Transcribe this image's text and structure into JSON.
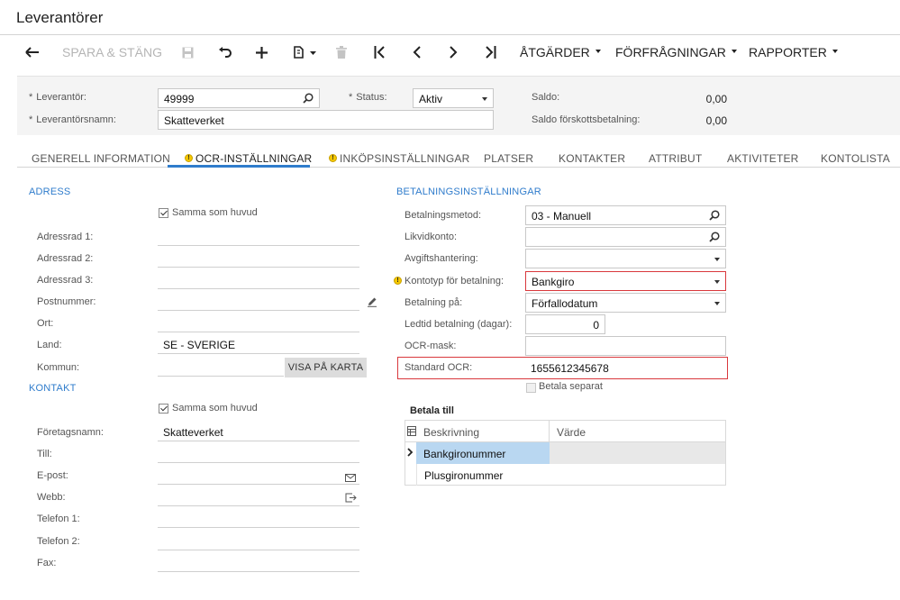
{
  "window": {
    "title": "Leverantörer"
  },
  "toolbar": {
    "save_close_label": "SPARA & STÄNG",
    "actions_label": "ÅTGÄRDER",
    "inquiries_label": "FÖRFRÅGNINGAR",
    "reports_label": "RAPPORTER",
    "icons": [
      "back-arrow-icon",
      "save-icon",
      "undo-icon",
      "add-icon",
      "copy-paste-icon",
      "delete-icon",
      "first-record-icon",
      "previous-record-icon",
      "next-record-icon",
      "last-record-icon"
    ]
  },
  "header": {
    "vendor_label": "Leverantör:",
    "vendor_value": "49999",
    "vendor_name_label": "Leverantörsnamn:",
    "vendor_name_value": "Skatteverket",
    "status_label": "Status:",
    "status_value": "Aktiv",
    "balance_label": "Saldo:",
    "balance_value": "0,00",
    "prepayment_balance_label": "Saldo förskottsbetalning:",
    "prepayment_balance_value": "0,00",
    "required_marker": "*"
  },
  "tabs": [
    {
      "label": "GENERELL INFORMATION",
      "warning": false,
      "active": false
    },
    {
      "label": "OCR-INSTÄLLNINGAR",
      "warning": true,
      "active": true
    },
    {
      "label": "INKÖPSINSTÄLLNINGAR",
      "warning": true,
      "active": false
    },
    {
      "label": "PLATSER",
      "warning": false,
      "active": false
    },
    {
      "label": "KONTAKTER",
      "warning": false,
      "active": false
    },
    {
      "label": "ATTRIBUT",
      "warning": false,
      "active": false
    },
    {
      "label": "AKTIVITETER",
      "warning": false,
      "active": false
    },
    {
      "label": "KONTOLISTA",
      "warning": false,
      "active": false
    }
  ],
  "address": {
    "section_title": "ADRESS",
    "same_as_main_label": "Samma som huvud",
    "same_as_main_checked": true,
    "line1_label": "Adressrad 1:",
    "line2_label": "Adressrad 2:",
    "line3_label": "Adressrad 3:",
    "postal_label": "Postnummer:",
    "city_label": "Ort:",
    "country_label": "Land:",
    "country_value": "SE - SVERIGE",
    "municipality_label": "Kommun:",
    "show_map_label": "VISA PÅ KARTA"
  },
  "contact": {
    "section_title": "KONTAKT",
    "same_as_main_label": "Samma som huvud",
    "same_as_main_checked": true,
    "company_label": "Företagsnamn:",
    "company_value": "Skatteverket",
    "attention_label": "Till:",
    "email_label": "E-post:",
    "web_label": "Webb:",
    "phone1_label": "Telefon 1:",
    "phone2_label": "Telefon 2:",
    "fax_label": "Fax:"
  },
  "payment": {
    "section_title": "BETALNINGSINSTÄLLNINGAR",
    "method_label": "Betalningsmetod:",
    "method_value": "03 - Manuell",
    "cash_account_label": "Likvidkonto:",
    "fee_handling_label": "Avgiftshantering:",
    "account_type_label": "Kontotyp för betalning:",
    "account_type_value": "Bankgiro",
    "pay_on_label": "Betalning på:",
    "pay_on_value": "Förfallodatum",
    "lead_time_label": "Ledtid betalning (dagar):",
    "lead_time_value": "0",
    "ocr_mask_label": "OCR-mask:",
    "standard_ocr_label": "Standard OCR:",
    "standard_ocr_value": "1655612345678",
    "pay_separately_label": "Betala separat",
    "pay_separately_checked": false
  },
  "pay_to": {
    "title": "Betala till",
    "columns": [
      "Beskrivning",
      "Värde"
    ],
    "rows": [
      {
        "description": "Bankgironummer",
        "value": "",
        "selected": true
      },
      {
        "description": "Plusgironummer",
        "value": "",
        "selected": false
      }
    ]
  },
  "colors": {
    "accent": "#2f7ccc",
    "highlight_box": "#d9383c",
    "selected_row": "#b9d7f1",
    "warning": "#f5c800"
  }
}
